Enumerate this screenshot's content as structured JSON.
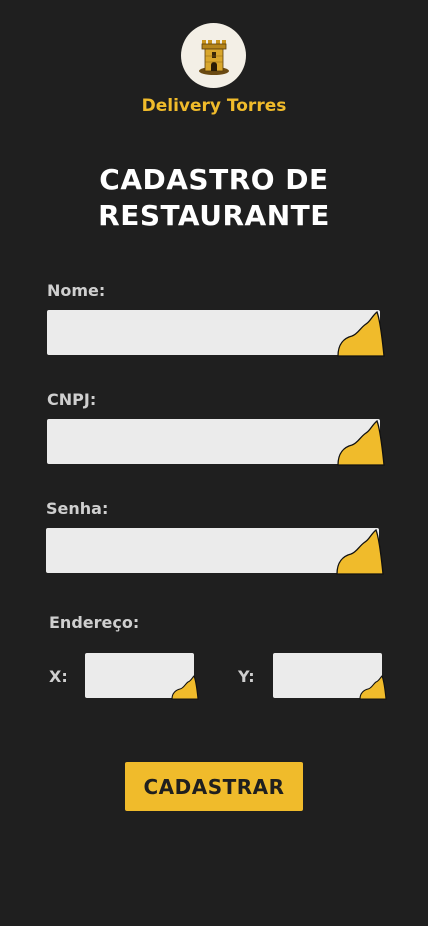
{
  "brand": {
    "name": "Delivery Torres",
    "logo_icon": "tower-icon"
  },
  "page": {
    "title_line1": "CADASTRO DE",
    "title_line2": "RESTAURANTE"
  },
  "form": {
    "name_label": "Nome:",
    "name_value": "",
    "cnpj_label": "CNPJ:",
    "cnpj_value": "",
    "password_label": "Senha:",
    "password_value": "",
    "address_label": "Endereço:",
    "x_label": "X:",
    "x_value": "",
    "y_label": "Y:",
    "y_value": "",
    "submit_label": "CADASTRAR"
  },
  "colors": {
    "background": "#1f1f1f",
    "accent": "#f0bb2b",
    "field": "#ebebeb",
    "label": "#cfcfcf"
  }
}
